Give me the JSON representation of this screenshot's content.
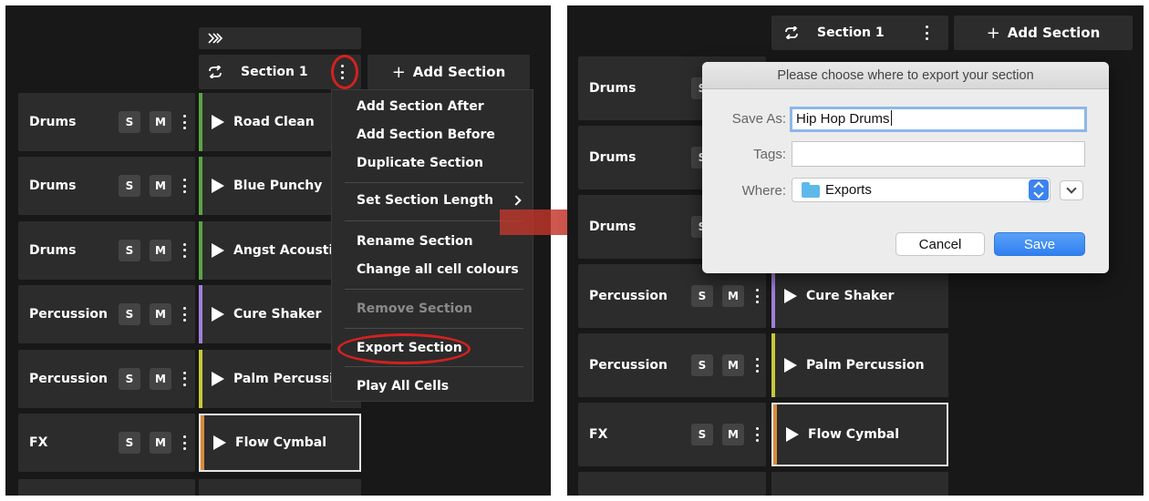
{
  "left": {
    "header_icon": "fast-forward-icon",
    "section_label": "Section 1",
    "add_section_label": "Add Section",
    "tracks": [
      {
        "name": "Drums",
        "cell": "Road Clean",
        "color": "#5aa446"
      },
      {
        "name": "Drums",
        "cell": "Blue Punchy",
        "color": "#5aa446"
      },
      {
        "name": "Drums",
        "cell": "Angst Acoustic",
        "color": "#5aa446"
      },
      {
        "name": "Percussion",
        "cell": "Cure Shaker",
        "color": "#a07fd8"
      },
      {
        "name": "Percussion",
        "cell": "Palm Percussion",
        "color": "#c8c83a"
      },
      {
        "name": "FX",
        "cell": "Flow Cymbal",
        "color": "#d98a3c"
      }
    ],
    "solo_label": "S",
    "mute_label": "M",
    "menu": {
      "items": [
        "Add Section After",
        "Add Section Before",
        "Duplicate Section",
        "Set Section Length",
        "Rename Section",
        "Change all cell colours",
        "Remove Section",
        "Export Section",
        "Play All Cells"
      ]
    }
  },
  "right": {
    "section_label": "Section 1",
    "add_section_label": "Add Section",
    "tracks": [
      {
        "name": "Drums"
      },
      {
        "name": "Drums"
      },
      {
        "name": "Drums"
      },
      {
        "name": "Percussion",
        "cell": "Cure Shaker",
        "color": "#a07fd8"
      },
      {
        "name": "Percussion",
        "cell": "Palm Percussion",
        "color": "#c8c83a"
      },
      {
        "name": "FX",
        "cell": "Flow Cymbal",
        "color": "#d98a3c"
      }
    ],
    "solo_label": "S",
    "mute_label": "M",
    "dialog": {
      "title": "Please choose where to export your section",
      "save_as_label": "Save As:",
      "save_as_value": "Hip Hop Drums",
      "tags_label": "Tags:",
      "tags_value": "",
      "where_label": "Where:",
      "where_value": "Exports",
      "cancel_label": "Cancel",
      "save_label": "Save"
    }
  },
  "colors": {
    "panel_bg": "#181818",
    "row_bg": "#2c2c2c",
    "highlight_red": "#d32121",
    "save_blue": "#2f7ff0"
  }
}
